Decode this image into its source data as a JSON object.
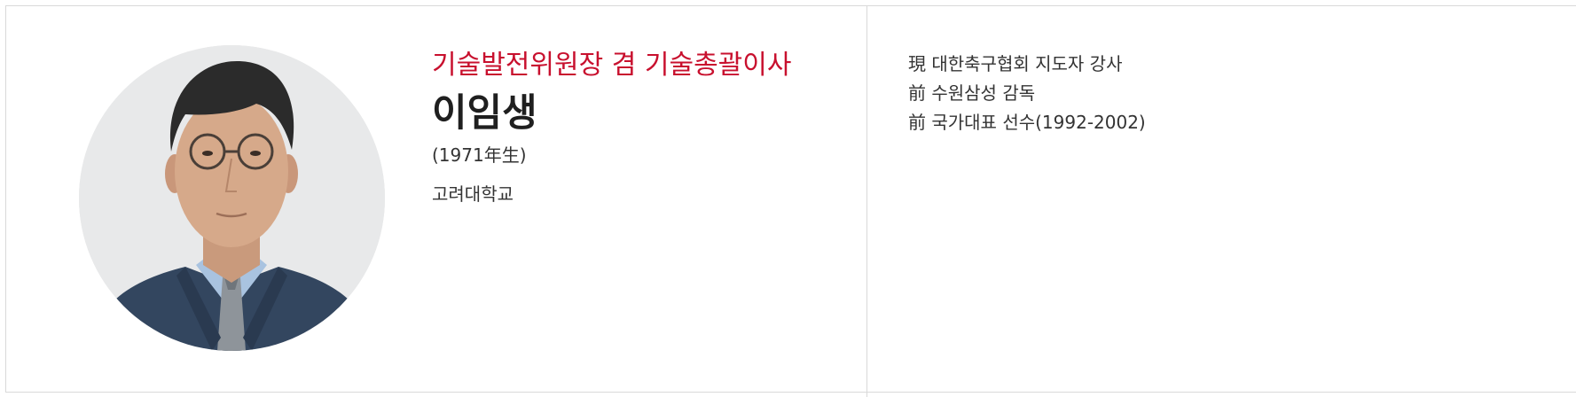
{
  "profile": {
    "title": "기술발전위원장 겸 기술총괄이사",
    "name": "이임생",
    "birth": "(1971年生)",
    "education": "고려대학교",
    "career": [
      "現 대한축구협회 지도자 강사",
      "前 수원삼성 감독",
      "前 국가대표 선수(1992-2002)"
    ]
  },
  "colors": {
    "accent": "#c8102e",
    "border": "#d9d9d9",
    "text": "#222222"
  }
}
